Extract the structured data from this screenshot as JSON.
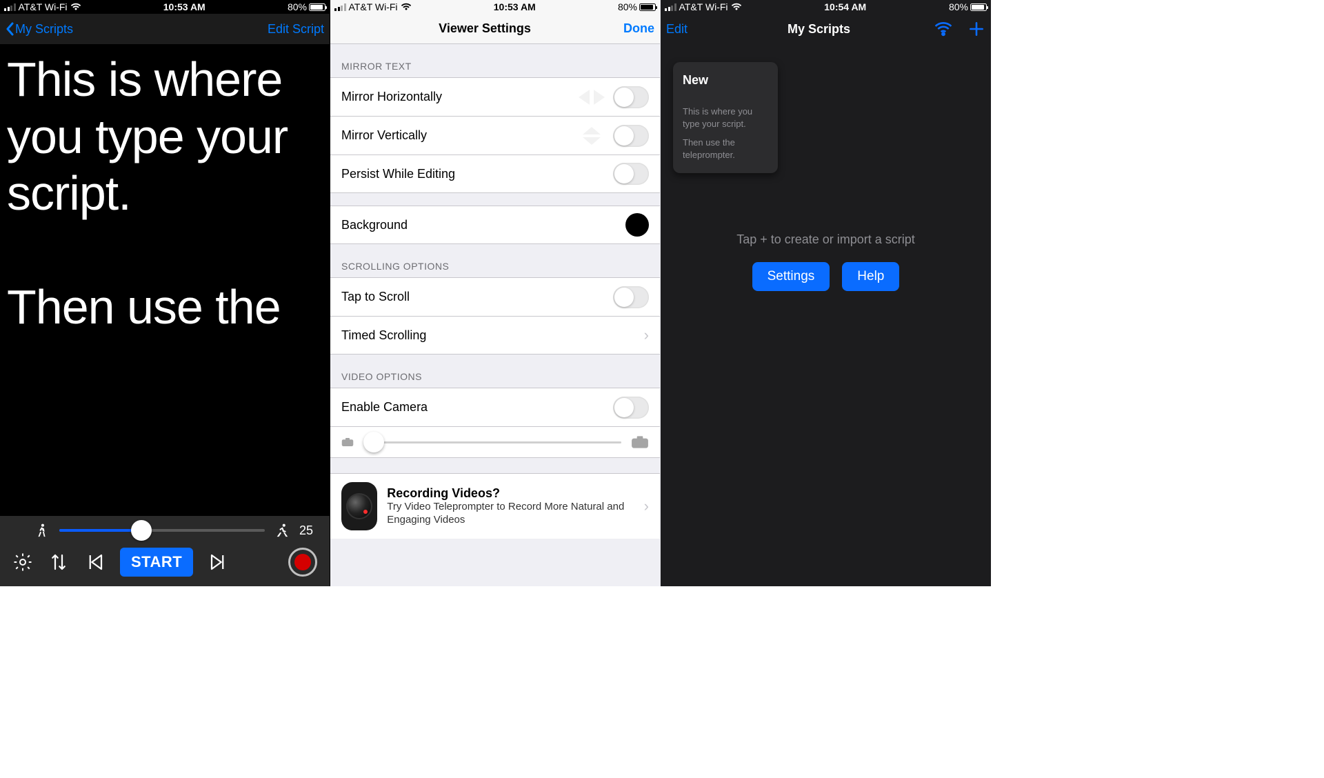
{
  "statusbar": {
    "carrier": "AT&T Wi-Fi",
    "time1": "10:53 AM",
    "time2": "10:53 AM",
    "time3": "10:54 AM",
    "battery_pct": "80%"
  },
  "screen1": {
    "back_label": "My Scripts",
    "right_label": "Edit Script",
    "script_text": "This is where you type your script.\n\nThen use the",
    "speed_value": "25",
    "start_label": "START"
  },
  "screen2": {
    "title": "Viewer Settings",
    "done": "Done",
    "sections": {
      "mirror_header": "MIRROR TEXT",
      "mirror_h": "Mirror Horizontally",
      "mirror_v": "Mirror Vertically",
      "persist": "Persist While Editing",
      "background": "Background",
      "background_color": "#000000",
      "scroll_header": "SCROLLING OPTIONS",
      "tap_scroll": "Tap to Scroll",
      "timed_scroll": "Timed Scrolling",
      "video_header": "VIDEO OPTIONS",
      "enable_camera": "Enable Camera"
    },
    "promo": {
      "title": "Recording Videos?",
      "subtitle": "Try Video Teleprompter to Record More Natural and Engaging Videos"
    }
  },
  "screen3": {
    "edit": "Edit",
    "title": "My Scripts",
    "card": {
      "title": "New",
      "preview_line1": "This is where you type your script.",
      "preview_line2": "Then use the teleprompter."
    },
    "hint": "Tap  +  to create or import a script",
    "settings_btn": "Settings",
    "help_btn": "Help"
  }
}
